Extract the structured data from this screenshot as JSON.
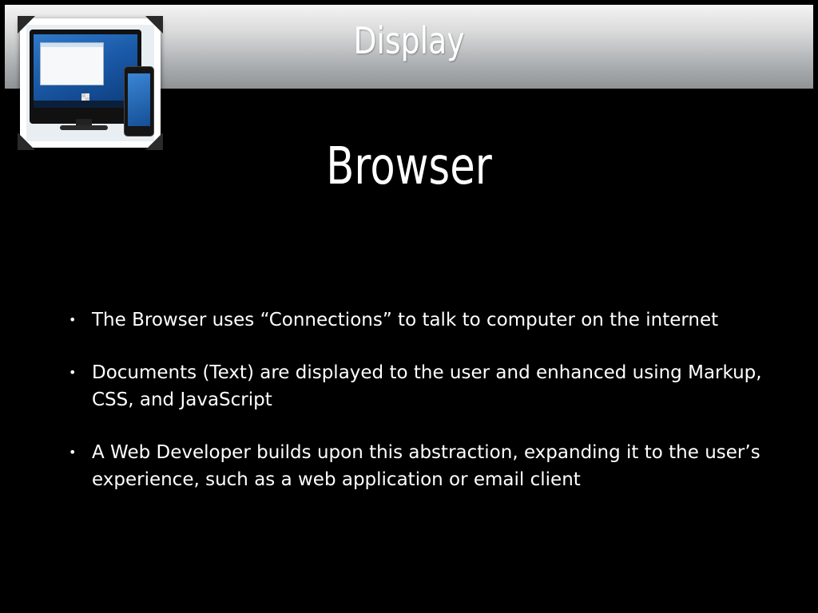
{
  "header": {
    "title": "Display"
  },
  "image": {
    "description_icon": "monitor-and-tablet-icon"
  },
  "slide": {
    "title": "Browser",
    "bullet_glyph": "•",
    "bullets": [
      {
        "text": "The Browser uses “Connections” to talk to computer on the internet"
      },
      {
        "text": "Documents (Text) are displayed to the user and enhanced using Markup, CSS, and JavaScript"
      },
      {
        "text": "A Web Developer builds upon this abstraction, expanding it to the user’s experience, such as a web application or email client"
      }
    ]
  },
  "colors": {
    "background": "#000000",
    "text": "#ffffff",
    "header_gradient_top": "#f4f4f4",
    "header_gradient_bottom": "#8f9396"
  }
}
